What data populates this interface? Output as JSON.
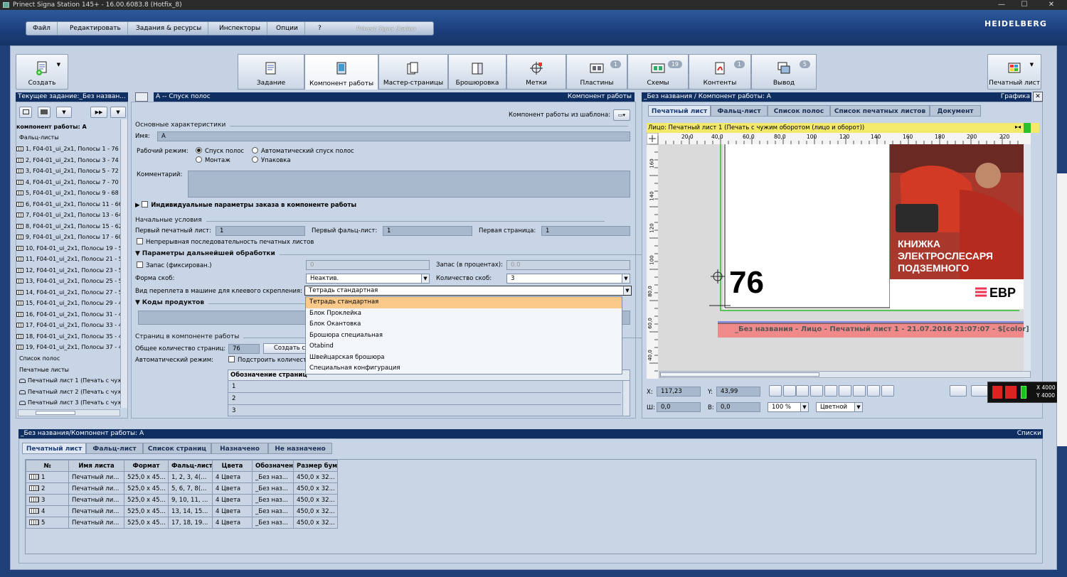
{
  "window": {
    "title": "Prinect Signa Station 145+  -  16.00.6083.8 (Hotfix_8)",
    "min": "—",
    "max": "☐",
    "close": "✕"
  },
  "menu": {
    "items": [
      "Файл",
      "Редактировать",
      "Задания & ресурсы",
      "Инспекторы",
      "Опции",
      "?"
    ],
    "brand": "Prinect Signa Station"
  },
  "logo": "HEIDELBERG",
  "toolbar": {
    "create": "Создать",
    "print_sheet": "Печатный лист"
  },
  "workflow_tabs": [
    {
      "label": "Задание",
      "badge": ""
    },
    {
      "label": "Компонент работы",
      "badge": ""
    },
    {
      "label": "Мастер-страницы",
      "badge": ""
    },
    {
      "label": "Брошюровка",
      "badge": ""
    },
    {
      "label": "Метки",
      "badge": ""
    },
    {
      "label": "Пластины",
      "badge": "1"
    },
    {
      "label": "Схемы",
      "badge": "19"
    },
    {
      "label": "Контенты",
      "badge": "1"
    },
    {
      "label": "Вывод",
      "badge": "5"
    }
  ],
  "left_panel": {
    "header": "Текущее задание:_Без назван...",
    "root": "компонент работы: A",
    "folds_label": "Фальц-листы",
    "folds": [
      "1, F04-01_ui_2x1, Полосы 1 - 76",
      "2, F04-01_ui_2x1, Полосы 3 - 74",
      "3, F04-01_ui_2x1, Полосы 5 - 72",
      "4, F04-01_ui_2x1, Полосы 7 - 70",
      "5, F04-01_ui_2x1, Полосы 9 - 68",
      "6, F04-01_ui_2x1, Полосы 11 - 66",
      "7, F04-01_ui_2x1, Полосы 13 - 64",
      "8, F04-01_ui_2x1, Полосы 15 - 62",
      "9, F04-01_ui_2x1, Полосы 17 - 60",
      "10, F04-01_ui_2x1, Полосы 19 - 5",
      "11, F04-01_ui_2x1, Полосы 21 - 5",
      "12, F04-01_ui_2x1, Полосы 23 - 5",
      "13, F04-01_ui_2x1, Полосы 25 - 5",
      "14, F04-01_ui_2x1, Полосы 27 - 5",
      "15, F04-01_ui_2x1, Полосы 29 - 4",
      "16, F04-01_ui_2x1, Полосы 31 - 4",
      "17, F04-01_ui_2x1, Полосы 33 - 4",
      "18, F04-01_ui_2x1, Полосы 35 - 4",
      "19, F04-01_ui_2x1, Полосы 37 - 4"
    ],
    "pages_list": "Список полос",
    "sheets_label": "Печатные листы",
    "sheets": [
      "Печатный лист 1 (Печать с чужи",
      "Печатный лист 2 (Печать с чужи",
      "Печатный лист 3 (Печать с чужи"
    ]
  },
  "center": {
    "header_left": "A -- Спуск полос",
    "header_right": "Компонент работы",
    "template_label": "Компонент работы из шаблона:",
    "basic_section": "Основные характеристики",
    "name_label": "Имя:",
    "name_value": "A",
    "mode_label": "Рабочий режим:",
    "modes": [
      "Спуск полос",
      "Автоматический спуск полос",
      "Монтаж",
      "Упаковка"
    ],
    "comment_label": "Комментарий:",
    "indiv_params": "Индивидуальные параметры заказа в компоненте работы",
    "start_section": "Начальные условия",
    "first_sheet_label": "Первый печатный лист:",
    "first_sheet_value": "1",
    "first_fold_label": "Первый фальц-лист:",
    "first_fold_value": "1",
    "first_page_label": "Первая страница:",
    "first_page_value": "1",
    "continuous": "Непрерывная последовательность печатных листов",
    "postpress_section": "Параметры дальнейшей обработки",
    "reserve_fixed": "Запас (фиксирован.)",
    "reserve_fixed_value": "0",
    "reserve_pct": "Запас (в процентах):",
    "reserve_pct_value": "0.0",
    "staple_form_label": "Форма скоб:",
    "staple_form_value": "Неактив.",
    "staple_count_label": "Количество скоб:",
    "staple_count_value": "3",
    "binding_label": "Вид переплета в машине для клеевого скрепления:",
    "binding_value": "Тетрадь стандартная",
    "binding_options": [
      "Тетрадь стандартная",
      "Блок Проклейка",
      "Блок Окантовка",
      "Брошюра специальная",
      "Otabind",
      "Швейцарская брошюра",
      "Специальная конфигурация"
    ],
    "product_codes": "Коды продуктов",
    "pages_section": "Страниц в компоненте работы",
    "total_pages_label": "Общее количество страниц:",
    "total_pages_value": "76",
    "create_btn": "Создать с",
    "auto_mode_label": "Автоматический режим:",
    "build_label": "Подстроить количест",
    "page_col": "Обозначение страниц",
    "page_rows": [
      "1",
      "2",
      "3"
    ]
  },
  "right": {
    "header": "_Без названия / Компонент работы: A",
    "header_right": "Графика",
    "tabs": [
      "Печатный лист",
      "Фальц-лист",
      "Список полос",
      "Список печатных листов",
      "Документ"
    ],
    "side_label": "Лицо:  Печатный лист 1 (Печать с чужим оборотом (лицо и оборот))",
    "ruler_h": [
      "20,0",
      "40,0",
      "60,0",
      "80,0",
      "100",
      "120",
      "140",
      "160",
      "180",
      "200",
      "220"
    ],
    "ruler_v": [
      "160",
      "140",
      "120",
      "100",
      "80,0",
      "60,0",
      "40,0"
    ],
    "page_number": "76",
    "book_title": [
      "КНИЖКА",
      "ЭЛЕКТРОСЛЕСАРЯ",
      "ПОДЗЕМНОГО"
    ],
    "brand_text": "ЕВР",
    "slug": "_Без названия - Лицо   - Печатный лист 1 - 21.07.2016 21:07:07 - $[color]",
    "x_label": "X:",
    "x_value": "117,23",
    "y_label": "Y:",
    "y_value": "43,99",
    "w_label": "Ш:",
    "w_value": "0,0",
    "h_label": "В:",
    "h_value": "0,0",
    "zoom": "100 %",
    "color_mode": "Цветной",
    "coord_x": "X 4000",
    "coord_y": "Y 4000"
  },
  "bottom": {
    "header": "_Без названия/Компонент работы: A",
    "header_right": "Списки",
    "tabs": [
      "Печатный лист",
      "Фальц-лист",
      "Список страниц",
      "Назначено",
      "Не назначено"
    ],
    "columns": [
      "№",
      "Имя листа",
      "Формат",
      "Фальц-лист",
      "Цвета",
      "Обозначени...",
      "Размер бум..."
    ],
    "rows": [
      [
        "1",
        "Печатный ли...",
        "525,0 x 45...",
        "1, 2, 3, 4(...",
        "4 Цвета",
        "_Без наз...",
        "450,0 x 32..."
      ],
      [
        "2",
        "Печатный ли...",
        "525,0 x 45...",
        "5, 6, 7, 8(...",
        "4 Цвета",
        "_Без наз...",
        "450,0 x 32..."
      ],
      [
        "3",
        "Печатный ли...",
        "525,0 x 45...",
        "9, 10, 11, ...",
        "4 Цвета",
        "_Без наз...",
        "450,0 x 32..."
      ],
      [
        "4",
        "Печатный ли...",
        "525,0 x 45...",
        "13, 14, 15...",
        "4 Цвета",
        "_Без наз...",
        "450,0 x 32..."
      ],
      [
        "5",
        "Печатный ли...",
        "525,0 x 45...",
        "17, 18, 19...",
        "4 Цвета",
        "_Без наз...",
        "450,0 x 32..."
      ]
    ]
  },
  "colors": {
    "accent": "#0f2f63",
    "selection": "#fbc98a",
    "slug_bg": "#f08a8a",
    "side_bar": "#f3e96a",
    "green": "#2dc02d"
  }
}
